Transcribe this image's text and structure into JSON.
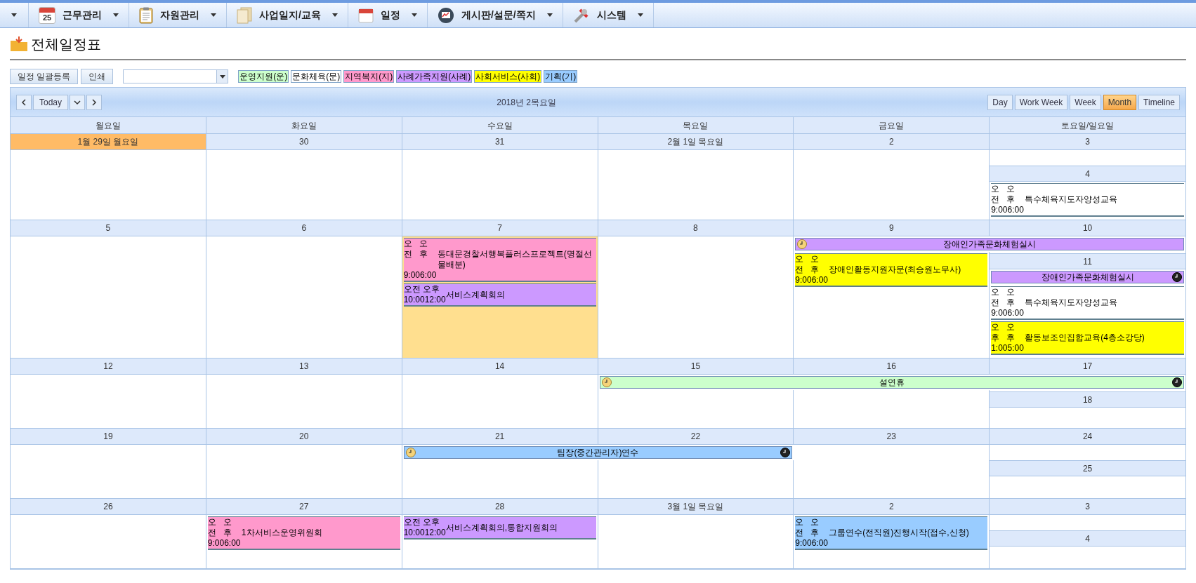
{
  "menu": [
    {
      "label": "근무관리",
      "icon_text": "25"
    },
    {
      "label": "자원관리"
    },
    {
      "label": "사업일지/교육"
    },
    {
      "label": "일정"
    },
    {
      "label": "게시판/설문/쪽지"
    },
    {
      "label": "시스템"
    }
  ],
  "page_title": "전체일정표",
  "toolbar": {
    "buttons": [
      "일정 일괄등록",
      "인쇄"
    ],
    "legend": [
      {
        "label": "운영지원(운)",
        "color": "#ccffcc"
      },
      {
        "label": "문화체육(문)",
        "color": "#ffffff"
      },
      {
        "label": "지역복지(지)",
        "color": "#ff99cc"
      },
      {
        "label": "사례가족지원(사례)",
        "color": "#cc99ff"
      },
      {
        "label": "사회서비스(사회)",
        "color": "#ffff00"
      },
      {
        "label": "기획(기)",
        "color": "#99ccff"
      }
    ]
  },
  "calendar": {
    "today_button": "Today",
    "title": "2018년 2목요일",
    "views": [
      {
        "label": "Day",
        "selected": false
      },
      {
        "label": "Work Week",
        "selected": false
      },
      {
        "label": "Week",
        "selected": false
      },
      {
        "label": "Month",
        "selected": true
      },
      {
        "label": "Timeline",
        "selected": false
      }
    ],
    "weekday_headers": [
      "월요일",
      "화요일",
      "수요일",
      "목요일",
      "금요일",
      "토요일/일요일"
    ],
    "weeks": [
      {
        "days": [
          {
            "date": "1월 29일 월요일",
            "today": true,
            "selected": false
          },
          {
            "date": "30",
            "today": false,
            "selected": false
          },
          {
            "date": "31",
            "today": false,
            "selected": false
          },
          {
            "date": "2월 1일 목요일",
            "today": false,
            "selected": false
          },
          {
            "date": "2",
            "today": false,
            "selected": false
          },
          {
            "date": "3",
            "today": false,
            "selected": false
          },
          {
            "date": "4",
            "today": false,
            "selected": false,
            "events": [
              {
                "kind": "stacked",
                "start_period": "오전",
                "end_period": "오후",
                "start_time": "9:00",
                "end_time": "6:00",
                "title": "특수체육지도자양성교육",
                "color": "#ffffff"
              }
            ]
          }
        ]
      },
      {
        "days": [
          {
            "date": "5",
            "today": false,
            "selected": false
          },
          {
            "date": "6",
            "today": false,
            "selected": false
          },
          {
            "date": "7",
            "today": false,
            "selected": true,
            "events": [
              {
                "kind": "stacked",
                "start_period": "오전",
                "end_period": "오후",
                "start_time": "9:00",
                "end_time": "6:00",
                "title": "동대문경찰서행복플러스프로젝트(명절선물배분)",
                "color": "#ff99cc"
              },
              {
                "kind": "inline",
                "start_period": "오전",
                "end_period": "오후",
                "start_time": "10:00",
                "end_time": "12:00",
                "title": "서비스계획회의",
                "color": "#cc99ff"
              }
            ]
          },
          {
            "date": "8",
            "today": false,
            "selected": false
          },
          {
            "date": "9",
            "today": false,
            "selected": false,
            "events": [
              {
                "kind": "span",
                "title": "장애인가족문화체험실시",
                "color": "#cc99ff",
                "start_clock": true,
                "end_clock": false
              },
              {
                "kind": "stacked",
                "start_period": "오전",
                "end_period": "오후",
                "start_time": "9:00",
                "end_time": "6:00",
                "title": "장애인활동지원자문(최승원노무사)",
                "color": "#ffff00"
              }
            ]
          },
          {
            "date": "10",
            "today": false,
            "selected": false,
            "spanned": true
          },
          {
            "date": "11",
            "today": false,
            "selected": false,
            "events": [
              {
                "kind": "bar",
                "title": "장애인가족문화체험실시",
                "color": "#cc99ff",
                "start_clock": false,
                "end_clock": true
              },
              {
                "kind": "stacked",
                "start_period": "오전",
                "end_period": "오후",
                "start_time": "9:00",
                "end_time": "6:00",
                "title": "특수체육지도자양성교육",
                "color": "#ffffff"
              },
              {
                "kind": "stacked",
                "start_period": "오후",
                "end_period": "오후",
                "start_time": "1:00",
                "end_time": "5:00",
                "title": "활동보조인집합교육(4층소강당)",
                "color": "#ffff00"
              }
            ]
          }
        ]
      },
      {
        "days": [
          {
            "date": "12",
            "today": false,
            "selected": false
          },
          {
            "date": "13",
            "today": false,
            "selected": false
          },
          {
            "date": "14",
            "today": false,
            "selected": false
          },
          {
            "date": "15",
            "today": false,
            "selected": false,
            "events": [
              {
                "kind": "span",
                "title": "설연휴",
                "color": "#ccffcc",
                "start_clock": true,
                "end_clock": true
              }
            ]
          },
          {
            "date": "16",
            "today": false,
            "selected": false,
            "spanned": true
          },
          {
            "date": "17",
            "today": false,
            "selected": false,
            "spanned": true
          },
          {
            "date": "18",
            "today": false,
            "selected": false
          }
        ]
      },
      {
        "days": [
          {
            "date": "19",
            "today": false,
            "selected": false
          },
          {
            "date": "20",
            "today": false,
            "selected": false
          },
          {
            "date": "21",
            "today": false,
            "selected": false,
            "events": [
              {
                "kind": "span",
                "title": "팀장(중간관리자)연수",
                "color": "#99ccff",
                "start_clock": true,
                "end_clock": true
              }
            ]
          },
          {
            "date": "22",
            "today": false,
            "selected": false,
            "spanned": true
          },
          {
            "date": "23",
            "today": false,
            "selected": false
          },
          {
            "date": "24",
            "today": false,
            "selected": false
          },
          {
            "date": "25",
            "today": false,
            "selected": false
          }
        ]
      },
      {
        "days": [
          {
            "date": "26",
            "today": false,
            "selected": false
          },
          {
            "date": "27",
            "today": false,
            "selected": false,
            "events": [
              {
                "kind": "stacked",
                "start_period": "오전",
                "end_period": "오후",
                "start_time": "9:00",
                "end_time": "6:00",
                "title": "1차서비스운영위원회",
                "color": "#ff99cc"
              }
            ]
          },
          {
            "date": "28",
            "today": false,
            "selected": false,
            "events": [
              {
                "kind": "inline",
                "start_period": "오전",
                "end_period": "오후",
                "start_time": "10:00",
                "end_time": "12:00",
                "title": "서비스계획회의,통합지원회의",
                "color": "#cc99ff"
              }
            ]
          },
          {
            "date": "3월 1일 목요일",
            "today": false,
            "selected": false
          },
          {
            "date": "2",
            "today": false,
            "selected": false,
            "events": [
              {
                "kind": "stacked",
                "start_period": "오전",
                "end_period": "오후",
                "start_time": "9:00",
                "end_time": "6:00",
                "title": "그룹연수(전직원)진행시작(접수,신청)",
                "color": "#99ccff"
              }
            ]
          },
          {
            "date": "3",
            "today": false,
            "selected": false
          },
          {
            "date": "4",
            "today": false,
            "selected": false
          }
        ]
      }
    ]
  }
}
